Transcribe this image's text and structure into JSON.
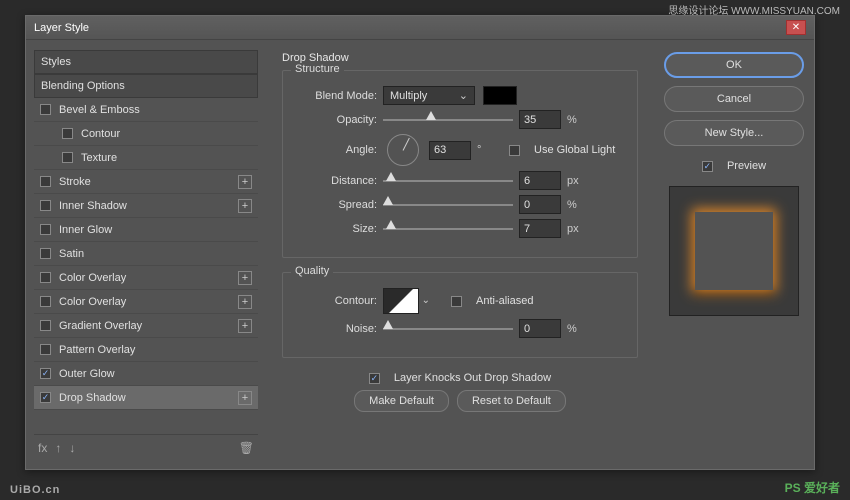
{
  "watermarks": {
    "top": "思缘设计论坛 WWW.MISSYUAN.COM",
    "bottomRight": "PS 爱好者",
    "bottomLeft": "UiBO.cn"
  },
  "window": {
    "title": "Layer Style"
  },
  "sidebar": {
    "items": [
      {
        "label": "Styles"
      },
      {
        "label": "Blending Options"
      },
      {
        "label": "Bevel & Emboss"
      },
      {
        "label": "Contour"
      },
      {
        "label": "Texture"
      },
      {
        "label": "Stroke"
      },
      {
        "label": "Inner Shadow"
      },
      {
        "label": "Inner Glow"
      },
      {
        "label": "Satin"
      },
      {
        "label": "Color Overlay"
      },
      {
        "label": "Color Overlay"
      },
      {
        "label": "Gradient Overlay"
      },
      {
        "label": "Pattern Overlay"
      },
      {
        "label": "Outer Glow"
      },
      {
        "label": "Drop Shadow"
      }
    ],
    "footer": {
      "fx": "fx"
    }
  },
  "main": {
    "title": "Drop Shadow",
    "structure": {
      "legend": "Structure",
      "blendModeLabel": "Blend Mode:",
      "blendModeValue": "Multiply",
      "opacityLabel": "Opacity:",
      "opacityValue": "35",
      "opacityUnit": "%",
      "angleLabel": "Angle:",
      "angleValue": "63",
      "angleUnit": "°",
      "useGlobalLight": "Use Global Light",
      "distanceLabel": "Distance:",
      "distanceValue": "6",
      "distanceUnit": "px",
      "spreadLabel": "Spread:",
      "spreadValue": "0",
      "spreadUnit": "%",
      "sizeLabel": "Size:",
      "sizeValue": "7",
      "sizeUnit": "px"
    },
    "quality": {
      "legend": "Quality",
      "contourLabel": "Contour:",
      "antiAliased": "Anti-aliased",
      "noiseLabel": "Noise:",
      "noiseValue": "0",
      "noiseUnit": "%"
    },
    "layerKnocksOut": "Layer Knocks Out Drop Shadow",
    "makeDefault": "Make Default",
    "resetDefault": "Reset to Default"
  },
  "right": {
    "ok": "OK",
    "cancel": "Cancel",
    "newStyle": "New Style...",
    "preview": "Preview"
  }
}
